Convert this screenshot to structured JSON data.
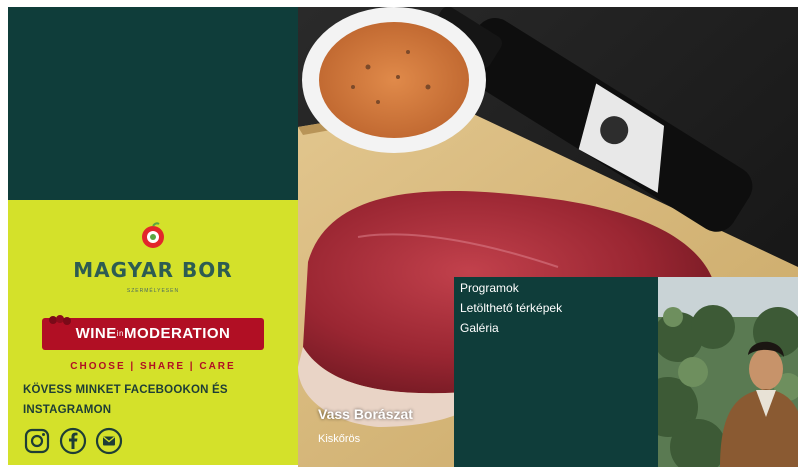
{
  "sidebar": {
    "brand_name": "MAGYAR BOR",
    "brand_tagline": "SZERMÉLYESEN",
    "badge_wine": "WINE",
    "badge_in": "in",
    "badge_moderation": "MODERATION",
    "badge_slogan": "CHOOSE | SHARE | CARE",
    "follow_text": "KÖVESS MINKET FACEBOOKON ÉS INSTAGRAMON",
    "social_icons": [
      "instagram-icon",
      "facebook-icon",
      "email-icon"
    ]
  },
  "hero": {
    "winery_name": "Vass Borászat",
    "winery_town": "Kiskőrös"
  },
  "menu": {
    "items": [
      {
        "label": "Programok"
      },
      {
        "label": "Letölthető térképek"
      },
      {
        "label": "Galéria"
      }
    ]
  },
  "colors": {
    "dark_green": "#0f3d3a",
    "lime": "#d4e12a",
    "wine_red": "#b10f24"
  }
}
